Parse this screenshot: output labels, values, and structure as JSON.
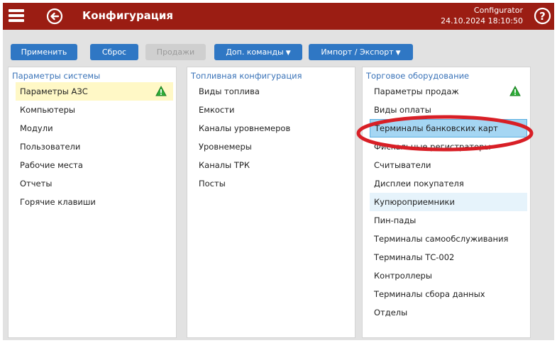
{
  "header": {
    "title": "Конфигурация",
    "user": "Configurator",
    "datetime": "24.10.2024 18:10:50",
    "menu_icon": "hamburger-menu-icon",
    "back_icon": "back-arrow-circle-icon",
    "help_icon": "help-circle-icon",
    "background_color": "#9b1d13"
  },
  "toolbar": {
    "apply_label": "Применить",
    "reset_label": "Сброс",
    "sales_label": "Продажи",
    "extra_commands_label": "Доп. команды",
    "import_export_label": "Импорт / Экспорт",
    "button_color": "#2f77c4"
  },
  "panels": [
    {
      "title": "Параметры системы",
      "items": [
        {
          "label": "Параметры АЗС",
          "selected": true,
          "warning": true
        },
        {
          "label": "Компьютеры"
        },
        {
          "label": "Модули"
        },
        {
          "label": "Пользователи"
        },
        {
          "label": "Рабочие места"
        },
        {
          "label": "Отчеты"
        },
        {
          "label": "Горячие клавиши"
        }
      ]
    },
    {
      "title": "Топливная конфигурация",
      "items": [
        {
          "label": "Виды топлива"
        },
        {
          "label": "Емкости"
        },
        {
          "label": "Каналы уровнемеров"
        },
        {
          "label": "Уровнемеры"
        },
        {
          "label": "Каналы ТРК"
        },
        {
          "label": "Посты"
        }
      ]
    },
    {
      "title": "Торговое оборудование",
      "items": [
        {
          "label": "Параметры продаж",
          "warning": true
        },
        {
          "label": "Виды оплаты"
        },
        {
          "label": "Терминалы банковских карт",
          "selected": true
        },
        {
          "label": "Фискальные регистраторы"
        },
        {
          "label": "Считыватели"
        },
        {
          "label": "Дисплеи покупателя"
        },
        {
          "label": "Купюроприемники",
          "hovered": true
        },
        {
          "label": "Пин-пады"
        },
        {
          "label": "Терминалы самообслуживания"
        },
        {
          "label": "Терминалы ТС-002"
        },
        {
          "label": "Контроллеры"
        },
        {
          "label": "Терминалы сбора данных"
        },
        {
          "label": "Отделы"
        }
      ]
    }
  ],
  "warning_icon": "warning-triangle-icon",
  "highlight_color": "#d81f26"
}
